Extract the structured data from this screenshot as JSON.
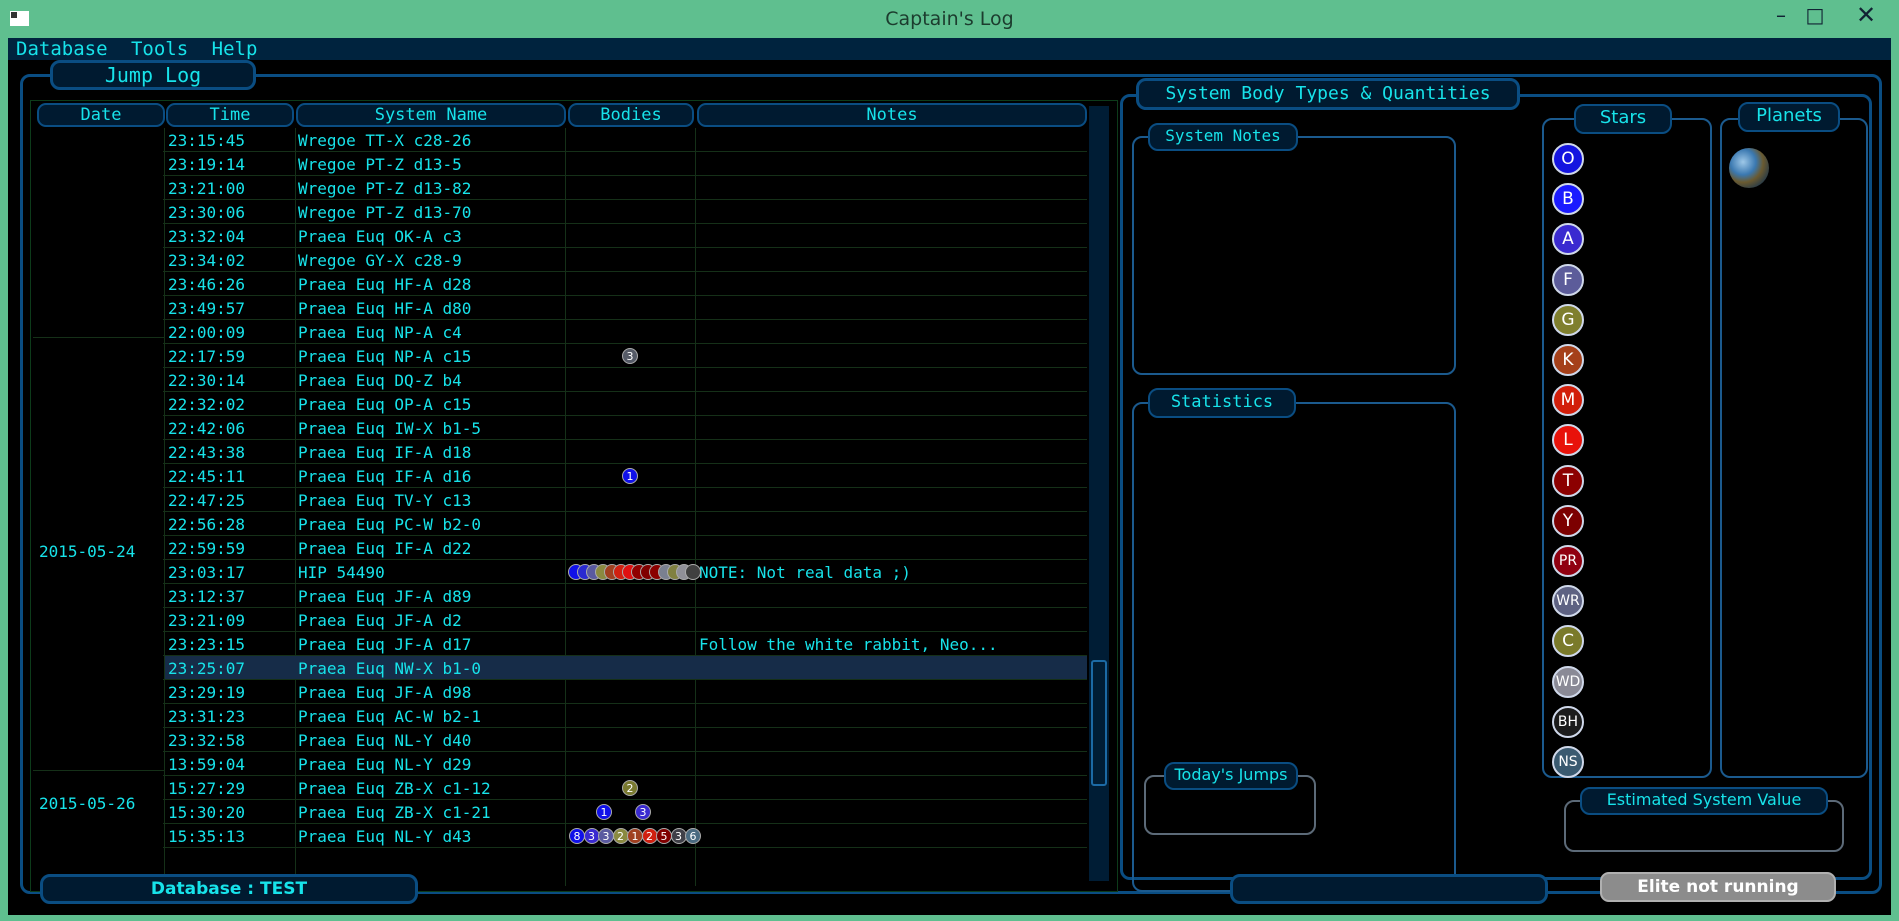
{
  "window": {
    "title": "Captain's Log"
  },
  "menu": [
    "Database",
    "Tools",
    "Help"
  ],
  "jump_log": {
    "title": "Jump Log",
    "columns": [
      "Date",
      "Time",
      "System Name",
      "Bodies",
      "Notes"
    ],
    "dates": [
      "2015-05-24",
      "2015-05-26"
    ],
    "rows": [
      {
        "time": "23:15:45",
        "system": "Wregoe TT-X c28-26",
        "notes": "",
        "bodies": []
      },
      {
        "time": "23:19:14",
        "system": "Wregoe PT-Z d13-5",
        "notes": "",
        "bodies": []
      },
      {
        "time": "23:21:00",
        "system": "Wregoe PT-Z d13-82",
        "notes": "",
        "bodies": []
      },
      {
        "time": "23:30:06",
        "system": "Wregoe PT-Z d13-70",
        "notes": "",
        "bodies": []
      },
      {
        "time": "23:32:04",
        "system": "Praea Euq OK-A c3",
        "notes": "",
        "bodies": []
      },
      {
        "time": "23:34:02",
        "system": "Wregoe GY-X c28-9",
        "notes": "",
        "bodies": []
      },
      {
        "time": "23:46:26",
        "system": "Praea Euq HF-A d28",
        "notes": "",
        "bodies": []
      },
      {
        "time": "23:49:57",
        "system": "Praea Euq HF-A d80",
        "notes": "",
        "bodies": []
      },
      {
        "time": "22:00:09",
        "system": "Praea Euq NP-A c4",
        "notes": "",
        "bodies": []
      },
      {
        "time": "22:17:59",
        "system": "Praea Euq NP-A c15",
        "notes": "",
        "bodies": [
          {
            "label": "3",
            "color": "#555a66"
          }
        ]
      },
      {
        "time": "22:30:14",
        "system": "Praea Euq DQ-Z b4",
        "notes": "",
        "bodies": []
      },
      {
        "time": "22:32:02",
        "system": "Praea Euq OP-A c15",
        "notes": "",
        "bodies": []
      },
      {
        "time": "22:42:06",
        "system": "Praea Euq IW-X b1-5",
        "notes": "",
        "bodies": []
      },
      {
        "time": "22:43:38",
        "system": "Praea Euq IF-A d18",
        "notes": "",
        "bodies": []
      },
      {
        "time": "22:45:11",
        "system": "Praea Euq IF-A d16",
        "notes": "",
        "bodies": [
          {
            "label": "1",
            "color": "#1010e8"
          }
        ]
      },
      {
        "time": "22:47:25",
        "system": "Praea Euq TV-Y c13",
        "notes": "",
        "bodies": []
      },
      {
        "time": "22:56:28",
        "system": "Praea Euq PC-W b2-0",
        "notes": "",
        "bodies": []
      },
      {
        "time": "22:59:59",
        "system": "Praea Euq IF-A d22",
        "notes": "",
        "bodies": []
      },
      {
        "time": "23:03:17",
        "system": "HIP 54490",
        "notes": "NOTE: Not real data ;)",
        "bodies": [
          {
            "label": "",
            "color": "#1010e8"
          },
          {
            "label": "",
            "color": "#2a2ad0"
          },
          {
            "label": "",
            "color": "#5a5aa0"
          },
          {
            "label": "",
            "color": "#8a8a40"
          },
          {
            "label": "",
            "color": "#a04020"
          },
          {
            "label": "",
            "color": "#d02010"
          },
          {
            "label": "",
            "color": "#e01010"
          },
          {
            "label": "",
            "color": "#900000"
          },
          {
            "label": "",
            "color": "#800000"
          },
          {
            "label": "",
            "color": "#8a0000"
          },
          {
            "label": "",
            "color": "#7a8090"
          },
          {
            "label": "",
            "color": "#808040"
          },
          {
            "label": "",
            "color": "#909098"
          },
          {
            "label": "",
            "color": "#404040"
          }
        ]
      },
      {
        "time": "23:12:37",
        "system": "Praea Euq JF-A d89",
        "notes": "",
        "bodies": []
      },
      {
        "time": "23:21:09",
        "system": "Praea Euq JF-A d2",
        "notes": "",
        "bodies": []
      },
      {
        "time": "23:23:15",
        "system": "Praea Euq JF-A d17",
        "notes": "Follow the white rabbit, Neo...",
        "bodies": []
      },
      {
        "time": "23:25:07",
        "system": "Praea Euq NW-X b1-0",
        "notes": "",
        "bodies": [],
        "selected": true
      },
      {
        "time": "23:29:19",
        "system": "Praea Euq JF-A d98",
        "notes": "",
        "bodies": []
      },
      {
        "time": "23:31:23",
        "system": "Praea Euq AC-W b2-1",
        "notes": "",
        "bodies": []
      },
      {
        "time": "23:32:58",
        "system": "Praea Euq NL-Y d40",
        "notes": "",
        "bodies": []
      },
      {
        "time": "13:59:04",
        "system": "Praea Euq NL-Y d29",
        "notes": "",
        "bodies": []
      },
      {
        "time": "15:27:29",
        "system": "Praea Euq ZB-X c1-12",
        "notes": "",
        "bodies": [
          {
            "label": "2",
            "color": "#7a7a30"
          }
        ]
      },
      {
        "time": "15:30:20",
        "system": "Praea Euq ZB-X c1-21",
        "notes": "",
        "bodies": [
          {
            "label": "1",
            "color": "#1010e8"
          },
          {
            "label": "",
            "color": ""
          },
          {
            "label": "",
            "color": ""
          },
          {
            "label": "3",
            "color": "#3a2ad0"
          }
        ]
      },
      {
        "time": "15:35:13",
        "system": "Praea Euq NL-Y d43",
        "notes": "",
        "bodies": [
          {
            "label": "8",
            "color": "#1010e8"
          },
          {
            "label": "3",
            "color": "#3a2ad0"
          },
          {
            "label": "3",
            "color": "#5a5aa0"
          },
          {
            "label": "2",
            "color": "#8a8a40"
          },
          {
            "label": "1",
            "color": "#a04020"
          },
          {
            "label": "2",
            "color": "#d02010"
          },
          {
            "label": "5",
            "color": "#800000"
          },
          {
            "label": "3",
            "color": "#404048"
          },
          {
            "label": "6",
            "color": "#4a6a80"
          }
        ]
      }
    ]
  },
  "body_types": {
    "title": "System Body Types & Quantities",
    "stars_title": "Stars",
    "planets_title": "Planets",
    "stars": [
      {
        "label": "O",
        "color": "#1414e0"
      },
      {
        "label": "B",
        "color": "#1a1aff"
      },
      {
        "label": "A",
        "color": "#3a2ad0"
      },
      {
        "label": "F",
        "color": "#5c5c9a"
      },
      {
        "label": "G",
        "color": "#7f7f2e"
      },
      {
        "label": "K",
        "color": "#a5401a"
      },
      {
        "label": "M",
        "color": "#d21e0a"
      },
      {
        "label": "L",
        "color": "#e8120a"
      },
      {
        "label": "T",
        "color": "#8c0000"
      },
      {
        "label": "Y",
        "color": "#7c0000"
      },
      {
        "label": "PR",
        "color": "#900010"
      },
      {
        "label": "WR",
        "color": "#5e6282"
      },
      {
        "label": "C",
        "color": "#7a7a2a"
      },
      {
        "label": "WD",
        "color": "#8a8a96"
      },
      {
        "label": "BH",
        "color": "#1c1c1c"
      },
      {
        "label": "NS",
        "color": "#3a5a70"
      }
    ]
  },
  "panels": {
    "system_notes": "System Notes",
    "statistics": "Statistics",
    "todays_jumps": "Today's Jumps",
    "estimated_value": "Estimated System Value"
  },
  "status": {
    "database": "Database : TEST",
    "middle": "",
    "elite": "Elite not running"
  }
}
